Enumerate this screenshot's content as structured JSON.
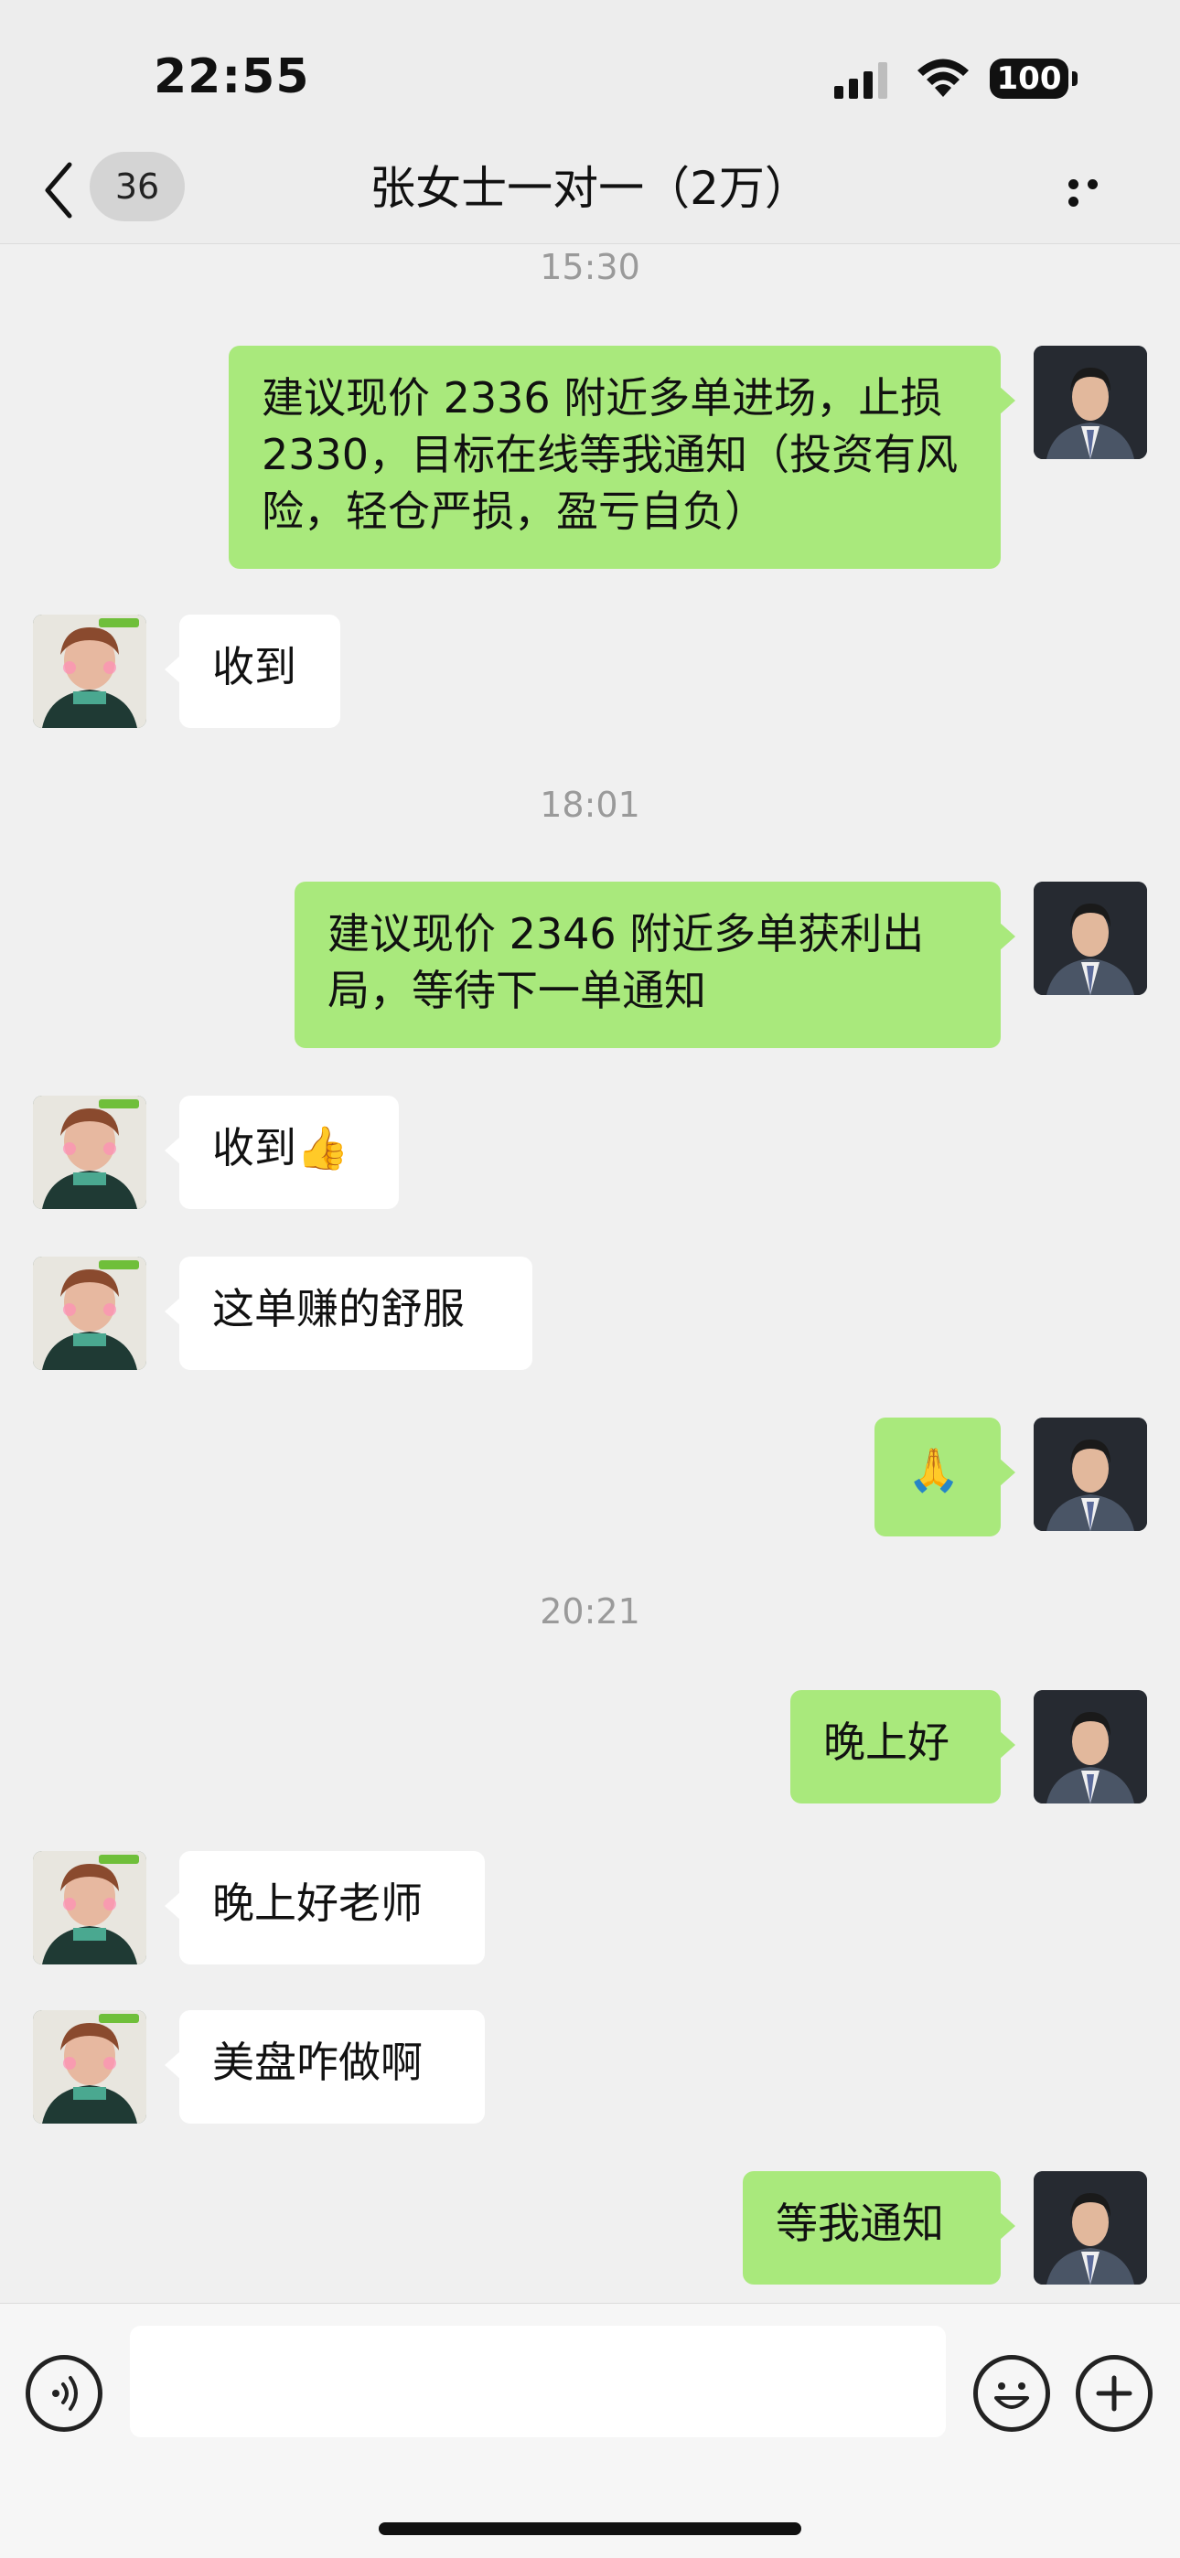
{
  "status_bar": {
    "time": "22:55",
    "battery": "100",
    "icons": [
      "signal-icon",
      "wifi-icon",
      "battery-icon"
    ]
  },
  "nav": {
    "unread_count": "36",
    "title": "张女士一对一（2万）",
    "icons": [
      "back-chevron-icon",
      "more-dots-icon"
    ]
  },
  "messages": [
    {
      "kind": "time",
      "text": "15:30"
    },
    {
      "kind": "msg",
      "sender": "self",
      "text": "建议现价 2336 附近多单进场，止损 2330，目标在线等我通知（投资有风险，轻仓严损，盈亏自负）"
    },
    {
      "kind": "msg",
      "sender": "other",
      "text": "收到"
    },
    {
      "kind": "time",
      "text": "18:01"
    },
    {
      "kind": "msg",
      "sender": "self",
      "text": "建议现价 2346 附近多单获利出局，等待下一单通知"
    },
    {
      "kind": "msg",
      "sender": "other",
      "text": "收到👍"
    },
    {
      "kind": "msg",
      "sender": "other",
      "text": "这单赚的舒服"
    },
    {
      "kind": "msg",
      "sender": "self",
      "text": "🙏"
    },
    {
      "kind": "time",
      "text": "20:21"
    },
    {
      "kind": "msg",
      "sender": "self",
      "text": "晚上好"
    },
    {
      "kind": "msg",
      "sender": "other",
      "text": "晚上好老师"
    },
    {
      "kind": "msg",
      "sender": "other",
      "text": "美盘咋做啊"
    },
    {
      "kind": "msg",
      "sender": "self",
      "text": "等我通知"
    }
  ],
  "input_bar": {
    "placeholder": "",
    "icons": [
      "voice-icon",
      "emoji-icon",
      "plus-icon"
    ]
  }
}
